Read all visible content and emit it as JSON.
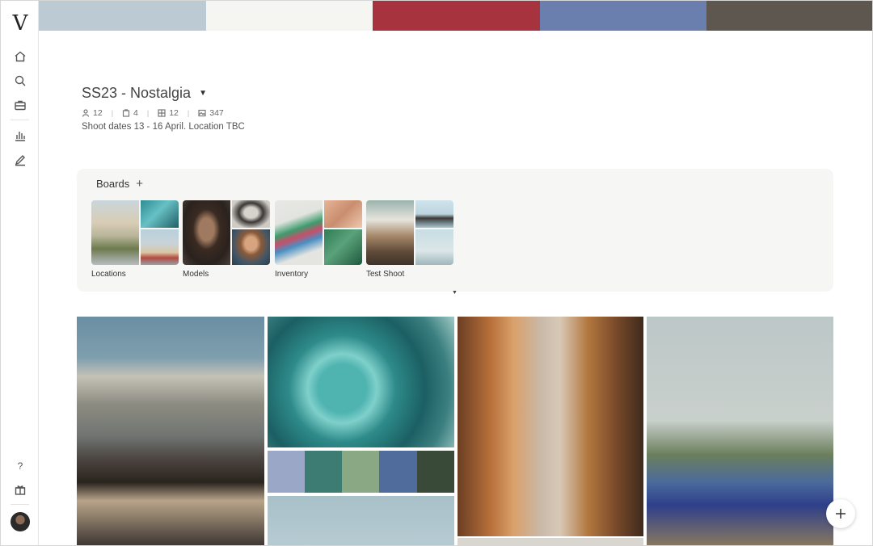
{
  "app": {
    "logo_text": "V"
  },
  "palette": [
    "#bccad3",
    "#f5f6f1",
    "#a7333f",
    "#6a7fad",
    "#5d5750"
  ],
  "project": {
    "title": "SS23 - Nostalgia",
    "stats": {
      "people": "12",
      "boards": "4",
      "items": "12",
      "images": "347"
    },
    "description": "Shoot dates 13 - 16 April. Location TBC"
  },
  "boards_section": {
    "title": "Boards",
    "add_icon": "plus-icon",
    "items": [
      {
        "label": "Locations"
      },
      {
        "label": "Models"
      },
      {
        "label": "Inventory"
      },
      {
        "label": "Test Shoot"
      }
    ]
  },
  "sidebar": {
    "icons": [
      "home-icon",
      "search-icon",
      "briefcase-icon",
      "bar-chart-icon",
      "pen-icon"
    ],
    "help_label": "?",
    "gift_icon": "gift-icon"
  },
  "palette_blocks": [
    "#9ba7c6",
    "#3d7c72",
    "#8aa884",
    "#4f6c9c",
    "#3a4a38"
  ],
  "fab_icon": "plus-icon"
}
